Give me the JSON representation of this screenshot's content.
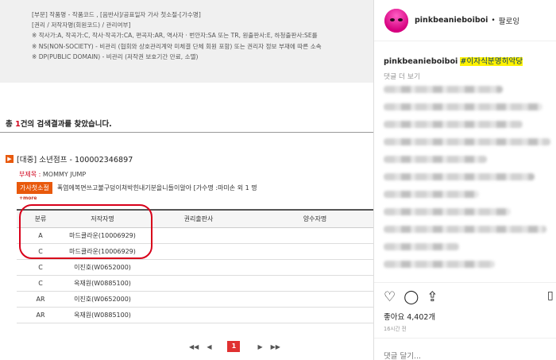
{
  "legend": {
    "lines": [
      "[부문] 작품명 - 작품코드 , [음반사]/공표일자 가사 첫소절-[가수명]",
      "[권리 / 저작자명(회원코드) / 관리여부]",
      "※ 작사가:A, 작곡가:C, 작사·작곡가:CA, 편곡자:AR, 역사자 · 번안자:SA 또는 TR, 원출판사:E, 하청출판사:SE를",
      "※ NS(NON-SOCIETY) - 비관리 (협회와 상호관리계약 미체결 단체 회원 포함) 또는 권리자 정보 부재에 따른 소속",
      "※ DP(PUBLIC DOMAIN) - 비관리 (저작권 보호기간 만료, 소멸)"
    ]
  },
  "search": {
    "summary_prefix": "총 ",
    "count": "1",
    "summary_suffix": "건의 검색결과를 찾았습니다."
  },
  "work": {
    "arrow": "▶",
    "title": "[대중] 소년점프 - 100002346897",
    "subtitle_label": "부제목 : ",
    "subtitle_value": "MOMMY JUMP",
    "lyric_badge": "가사첫소절",
    "lyric_text": "폭염에복면쓰고불구덩이쳐박힌내기분을니들이알아 [가수명 :마미손 외 1 명",
    "more": "+more"
  },
  "rights_table": {
    "headers": [
      "분류",
      "저작자명",
      "권리출판사",
      "양수자명"
    ],
    "rows": [
      [
        "A",
        "마드클라운(10006929)",
        "",
        ""
      ],
      [
        "C",
        "마드클라운(10006929)",
        "",
        ""
      ],
      [
        "C",
        "이진호(W0652000)",
        "",
        ""
      ],
      [
        "C",
        "옥재원(W0885100)",
        "",
        ""
      ],
      [
        "AR",
        "이진호(W0652000)",
        "",
        ""
      ],
      [
        "AR",
        "옥재원(W0885100)",
        "",
        ""
      ]
    ]
  },
  "pager": {
    "first": "◀◀",
    "prev": "◀",
    "current": "1",
    "next": "▶",
    "last": "▶▶"
  },
  "instagram": {
    "username": "pinkbeanieboiboi",
    "dot": "•",
    "follow_label": "팔로잉",
    "caption_user": "pinkbeanieboiboi",
    "caption_hashtag": "#이자식분명히악당",
    "more_comments": "댓글 더 보기",
    "likes": "좋아요 4,402개",
    "time": "16시간 전",
    "comment_placeholder": "댓글 달기...",
    "icons": {
      "like": "heart-icon",
      "comment": "comment-icon",
      "share": "share-icon",
      "save": "bookmark-icon"
    },
    "accent_color": "#e91e9c",
    "highlight_color": "#fff200"
  }
}
